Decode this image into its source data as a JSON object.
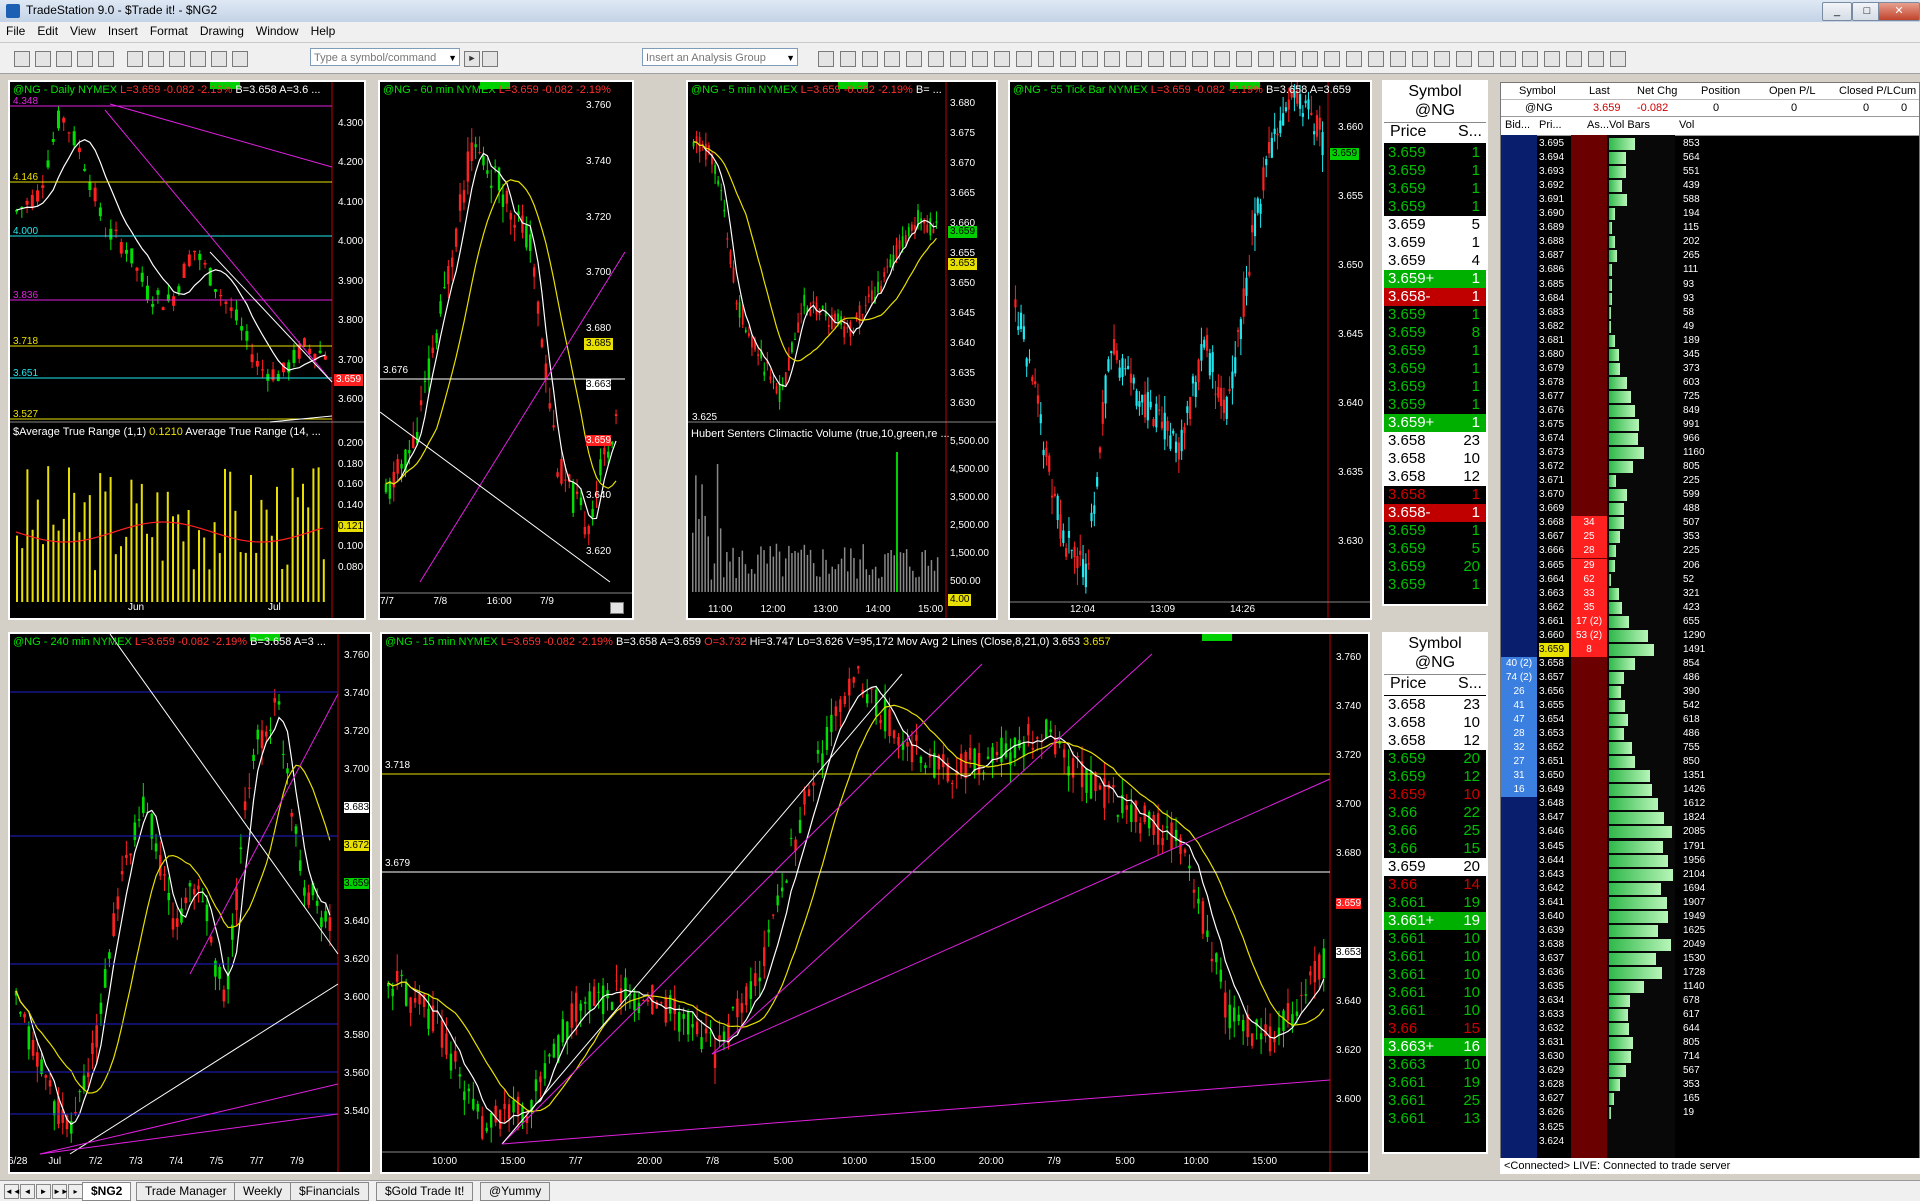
{
  "app": {
    "title": "TradeStation 9.0 - $Trade it! - $NG2",
    "min": "_",
    "max": "□",
    "close": "✕"
  },
  "menu": [
    "File",
    "Edit",
    "View",
    "Insert",
    "Format",
    "Drawing",
    "Window",
    "Help"
  ],
  "toolbar": {
    "symbol_placeholder": "Type a symbol/command",
    "analysis_placeholder": "Insert an Analysis Group"
  },
  "charts": {
    "daily": {
      "hdr": [
        "@NG - Daily  NYMEX  ",
        "L=3.659 -0.082 -2.19%",
        "  B=3.658  A=3.6 ..."
      ],
      "ticks": [
        "4.300",
        "4.200",
        "4.100",
        "4.000",
        "3.900",
        "3.800",
        "3.700",
        "3.600"
      ],
      "levels": [
        "4.348",
        "4.146",
        "4.000",
        "3.836",
        "3.718",
        "3.651",
        "3.527"
      ],
      "price_tag": "3.659",
      "ind_title": "$Average True Range (1,1)",
      "ind_value": "0.1210",
      "ind_title2": "Average True Range (14, ...",
      "ind_ticks": [
        "0.200",
        "0.180",
        "0.160",
        "0.140",
        "0.121",
        "0.100",
        "0.080"
      ],
      "x": [
        "Jun",
        "Jul"
      ]
    },
    "m60": {
      "hdr": [
        "@NG - 60 min  NYMEX  ",
        "L=3.659 -0.082 -2.19%"
      ],
      "ticks": [
        "3.760",
        "3.740",
        "3.720",
        "3.700",
        "3.680",
        "3.663",
        "3.659",
        "3.640",
        "3.620"
      ],
      "level": "3.676",
      "tag": "3.685",
      "x": [
        "7/7",
        "7/8",
        "16:00",
        "7/9"
      ]
    },
    "m5": {
      "hdr": [
        "@NG - 5 min  NYMEX  ",
        "L=3.659 -0.082 -2.19%",
        "  B= ..."
      ],
      "ticks": [
        "3.680",
        "3.675",
        "3.670",
        "3.665",
        "3.660",
        "3.655",
        "3.650",
        "3.645",
        "3.640",
        "3.635",
        "3.630"
      ],
      "tags": [
        "3.659",
        "3.653"
      ],
      "low_label": "3.625",
      "ind_title": "Hubert Senters Climactic Volume (true,10,green,re ...",
      "ind_ticks": [
        "5,500.00",
        "4,500.00",
        "3,500.00",
        "2,500.00",
        "1,500.00",
        "500.00"
      ],
      "ind_tag": "4.00",
      "x": [
        "11:00",
        "12:00",
        "13:00",
        "14:00",
        "15:00"
      ]
    },
    "tick55": {
      "hdr": [
        "@NG - 55 Tick Bar  NYMEX  ",
        "L=3.659 -0.082 -2.19%",
        "  B=3.658  A=3.659"
      ],
      "ticks": [
        "3.660",
        "3.655",
        "3.650",
        "3.645",
        "3.640",
        "3.635",
        "3.630"
      ],
      "tag": "3.659",
      "x": [
        "12:04",
        "13:09",
        "14:26"
      ]
    },
    "m240": {
      "hdr": [
        "@NG - 240 min  NYMEX  ",
        "L=3.659 -0.082 -2.19%",
        "  B=3.658  A=3 ..."
      ],
      "ticks": [
        "3.760",
        "3.740",
        "3.720",
        "3.700",
        "3.683",
        "3.672",
        "3.659",
        "3.640",
        "3.620",
        "3.600",
        "3.580",
        "3.560",
        "3.540"
      ],
      "x": [
        "6/28",
        "Jul",
        "7/2",
        "7/3",
        "7/4",
        "7/5",
        "7/7",
        "7/9"
      ]
    },
    "m15": {
      "hdr": [
        "@NG - 15 min  NYMEX  ",
        "L=3.659 -0.082 -2.19%",
        "  B=3.658  A=3.659  ",
        "O=3.732",
        "  Hi=3.747  Lo=3.626  V=95,172  Mov Avg 2 Lines (Close,8,21,0)  ",
        "3.653",
        "  3.657"
      ],
      "ticks": [
        "3.760",
        "3.740",
        "3.720",
        "3.700",
        "3.680",
        "3.659",
        "3.653",
        "3.640",
        "3.620",
        "3.600"
      ],
      "levels": [
        "3.718",
        "3.679"
      ],
      "x": [
        "10:00",
        "15:00",
        "7/7",
        "20:00",
        "7/8",
        "5:00",
        "10:00",
        "15:00",
        "20:00",
        "7/9",
        "5:00",
        "10:00",
        "15:00"
      ]
    }
  },
  "matrix_top": {
    "symbol_label": "Symbol",
    "symbol": "@NG",
    "col_price": "Price",
    "col_size": "S...",
    "rows": [
      {
        "p": "3.659",
        "s": "1",
        "c": "g"
      },
      {
        "p": "3.659",
        "s": "1",
        "c": "g"
      },
      {
        "p": "3.659",
        "s": "1",
        "c": "g"
      },
      {
        "p": "3.659",
        "s": "1",
        "c": "g"
      },
      {
        "p": "3.659",
        "s": "5",
        "c": "w"
      },
      {
        "p": "3.659",
        "s": "1",
        "c": "w"
      },
      {
        "p": "3.659",
        "s": "4",
        "c": "w"
      },
      {
        "p": "3.659+",
        "s": "1",
        "c": "G"
      },
      {
        "p": "3.658-",
        "s": "1",
        "c": "R"
      },
      {
        "p": "3.659",
        "s": "1",
        "c": "g"
      },
      {
        "p": "3.659",
        "s": "8",
        "c": "g"
      },
      {
        "p": "3.659",
        "s": "1",
        "c": "g"
      },
      {
        "p": "3.659",
        "s": "1",
        "c": "g"
      },
      {
        "p": "3.659",
        "s": "1",
        "c": "g"
      },
      {
        "p": "3.659",
        "s": "1",
        "c": "g"
      },
      {
        "p": "3.659+",
        "s": "1",
        "c": "G"
      },
      {
        "p": "3.658",
        "s": "23",
        "c": "w"
      },
      {
        "p": "3.658",
        "s": "10",
        "c": "w"
      },
      {
        "p": "3.658",
        "s": "12",
        "c": "w"
      },
      {
        "p": "3.658",
        "s": "1",
        "c": "r"
      },
      {
        "p": "3.658-",
        "s": "1",
        "c": "R"
      },
      {
        "p": "3.659",
        "s": "1",
        "c": "g"
      },
      {
        "p": "3.659",
        "s": "5",
        "c": "g"
      },
      {
        "p": "3.659",
        "s": "20",
        "c": "g"
      },
      {
        "p": "3.659",
        "s": "1",
        "c": "g"
      }
    ]
  },
  "matrix_bottom": {
    "symbol_label": "Symbol",
    "symbol": "@NG",
    "col_price": "Price",
    "col_size": "S...",
    "rows": [
      {
        "p": "3.658",
        "s": "23",
        "c": "w"
      },
      {
        "p": "3.658",
        "s": "10",
        "c": "w"
      },
      {
        "p": "3.658",
        "s": "12",
        "c": "w"
      },
      {
        "p": "3.659",
        "s": "20",
        "c": "g"
      },
      {
        "p": "3.659",
        "s": "12",
        "c": "g"
      },
      {
        "p": "3.659",
        "s": "10",
        "c": "r"
      },
      {
        "p": "3.66",
        "s": "22",
        "c": "g"
      },
      {
        "p": "3.66",
        "s": "25",
        "c": "g"
      },
      {
        "p": "3.66",
        "s": "15",
        "c": "g"
      },
      {
        "p": "3.659",
        "s": "20",
        "c": "w"
      },
      {
        "p": "3.66",
        "s": "14",
        "c": "r"
      },
      {
        "p": "3.661",
        "s": "19",
        "c": "g"
      },
      {
        "p": "3.661+",
        "s": "19",
        "c": "G"
      },
      {
        "p": "3.661",
        "s": "10",
        "c": "g"
      },
      {
        "p": "3.661",
        "s": "10",
        "c": "g"
      },
      {
        "p": "3.661",
        "s": "10",
        "c": "g"
      },
      {
        "p": "3.661",
        "s": "10",
        "c": "g"
      },
      {
        "p": "3.661",
        "s": "10",
        "c": "g"
      },
      {
        "p": "3.66",
        "s": "15",
        "c": "r"
      },
      {
        "p": "3.663+",
        "s": "16",
        "c": "G"
      },
      {
        "p": "3.663",
        "s": "10",
        "c": "g"
      },
      {
        "p": "3.661",
        "s": "19",
        "c": "g"
      },
      {
        "p": "3.661",
        "s": "25",
        "c": "g"
      },
      {
        "p": "3.661",
        "s": "13",
        "c": "g"
      }
    ]
  },
  "dom": {
    "headers": [
      "Symbol",
      "Last",
      "Net Chg",
      "Position",
      "Open P/L",
      "Closed P/L",
      "Cum P/"
    ],
    "values": [
      "@NG",
      "3.659",
      "-0.082",
      "0",
      "0",
      "0",
      "0"
    ],
    "cols": [
      "Bid...",
      "Pri...",
      "As...",
      "Vol Bars",
      "Vol"
    ],
    "rows": [
      {
        "price": "3.695",
        "vol": "853"
      },
      {
        "price": "3.694",
        "vol": "564"
      },
      {
        "price": "3.693",
        "vol": "551"
      },
      {
        "price": "3.692",
        "vol": "439"
      },
      {
        "price": "3.691",
        "vol": "588"
      },
      {
        "price": "3.690",
        "vol": "194"
      },
      {
        "price": "3.689",
        "vol": "115"
      },
      {
        "price": "3.688",
        "vol": "202"
      },
      {
        "price": "3.687",
        "vol": "265"
      },
      {
        "price": "3.686",
        "vol": "111"
      },
      {
        "price": "3.685",
        "vol": "93"
      },
      {
        "price": "3.684",
        "vol": "93"
      },
      {
        "price": "3.683",
        "vol": "58"
      },
      {
        "price": "3.682",
        "vol": "49"
      },
      {
        "price": "3.681",
        "vol": "189"
      },
      {
        "price": "3.680",
        "vol": "345"
      },
      {
        "price": "3.679",
        "vol": "373"
      },
      {
        "price": "3.678",
        "vol": "603"
      },
      {
        "price": "3.677",
        "vol": "725"
      },
      {
        "price": "3.676",
        "vol": "849"
      },
      {
        "price": "3.675",
        "vol": "991"
      },
      {
        "price": "3.674",
        "vol": "966"
      },
      {
        "price": "3.673",
        "vol": "1160"
      },
      {
        "price": "3.672",
        "vol": "805"
      },
      {
        "price": "3.671",
        "vol": "225"
      },
      {
        "price": "3.670",
        "vol": "599"
      },
      {
        "price": "3.669",
        "vol": "488"
      },
      {
        "price": "3.668",
        "ask": "34",
        "vol": "507"
      },
      {
        "price": "3.667",
        "ask": "25",
        "vol": "353"
      },
      {
        "price": "3.666",
        "ask": "28",
        "vol": "225"
      },
      {
        "price": "3.665",
        "ask": "29",
        "vol": "206"
      },
      {
        "price": "3.664",
        "ask": "62",
        "vol": "52"
      },
      {
        "price": "3.663",
        "ask": "33",
        "vol": "321"
      },
      {
        "price": "3.662",
        "ask": "35",
        "vol": "423"
      },
      {
        "price": "3.661",
        "ask": "17 (2)",
        "vol": "655"
      },
      {
        "price": "3.660",
        "ask": "53 (2)",
        "vol": "1290"
      },
      {
        "price": "3.659",
        "ask": "8",
        "vol": "1491",
        "last": true
      },
      {
        "bid": "40 (2)",
        "price": "3.658",
        "vol": "854"
      },
      {
        "bid": "74 (2)",
        "price": "3.657",
        "vol": "486"
      },
      {
        "bid": "26",
        "price": "3.656",
        "vol": "390"
      },
      {
        "bid": "41",
        "price": "3.655",
        "vol": "542"
      },
      {
        "bid": "47",
        "price": "3.654",
        "vol": "618"
      },
      {
        "bid": "28",
        "price": "3.653",
        "vol": "486"
      },
      {
        "bid": "32",
        "price": "3.652",
        "vol": "755"
      },
      {
        "bid": "27",
        "price": "3.651",
        "vol": "850"
      },
      {
        "bid": "31",
        "price": "3.650",
        "vol": "1351"
      },
      {
        "bid": "16",
        "price": "3.649",
        "vol": "1426"
      },
      {
        "price": "3.648",
        "vol": "1612"
      },
      {
        "price": "3.647",
        "vol": "1824"
      },
      {
        "price": "3.646",
        "vol": "2085"
      },
      {
        "price": "3.645",
        "vol": "1791"
      },
      {
        "price": "3.644",
        "vol": "1956"
      },
      {
        "price": "3.643",
        "vol": "2104"
      },
      {
        "price": "3.642",
        "vol": "1694"
      },
      {
        "price": "3.641",
        "vol": "1907"
      },
      {
        "price": "3.640",
        "vol": "1949"
      },
      {
        "price": "3.639",
        "vol": "1625"
      },
      {
        "price": "3.638",
        "vol": "2049"
      },
      {
        "price": "3.637",
        "vol": "1530"
      },
      {
        "price": "3.636",
        "vol": "1728"
      },
      {
        "price": "3.635",
        "vol": "1140"
      },
      {
        "price": "3.634",
        "vol": "678"
      },
      {
        "price": "3.633",
        "vol": "617"
      },
      {
        "price": "3.632",
        "vol": "644"
      },
      {
        "price": "3.631",
        "vol": "805"
      },
      {
        "price": "3.630",
        "vol": "714"
      },
      {
        "price": "3.629",
        "vol": "567"
      },
      {
        "price": "3.628",
        "vol": "353"
      },
      {
        "price": "3.627",
        "vol": "165"
      },
      {
        "price": "3.626",
        "vol": "19"
      },
      {
        "price": "3.625",
        "vol": ""
      },
      {
        "price": "3.624",
        "vol": ""
      }
    ],
    "status": "<Connected>  LIVE:  Connected to trade server"
  },
  "tabs": [
    "$NG2",
    "Trade Manager",
    "Weekly",
    "$Financials",
    "$Gold Trade It!",
    "@Yummy"
  ],
  "colors": {
    "up": "#00e000",
    "down": "#ff2020",
    "cyan": "#20e8f0",
    "ma_fast": "#ffffff",
    "ma_slow": "#e8e000",
    "trend": "#e020e0",
    "accent_blue": "#1c5fb3"
  }
}
